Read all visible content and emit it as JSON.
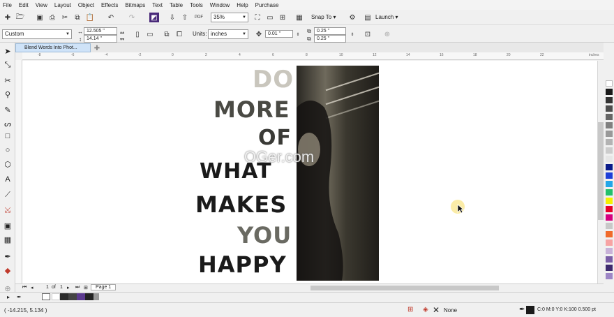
{
  "menu": [
    "File",
    "Edit",
    "View",
    "Layout",
    "Object",
    "Effects",
    "Bitmaps",
    "Text",
    "Table",
    "Tools",
    "Window",
    "Help",
    "Purchase"
  ],
  "toolbar": {
    "zoom_value": "35%",
    "snap_label": "Snap To",
    "launch_label": "Launch",
    "page_preset": "Custom",
    "width_value": "12.505 \"",
    "height_value": "14.14 \"",
    "units_label": "Units:",
    "units_value": "inches",
    "nudge_value": "0.01 \"",
    "dup_x": "0.25 \"",
    "dup_y": "0.25 \""
  },
  "document": {
    "tab_title": "Blend Words Into Phot..."
  },
  "ruler": {
    "h_ticks": [
      "-8",
      "-6",
      "-4",
      "-2",
      "0",
      "2",
      "4",
      "6",
      "8",
      "10",
      "12",
      "14",
      "16",
      "18",
      "20",
      "22"
    ],
    "unit": "inches"
  },
  "artwork": {
    "lines": [
      "DO",
      "MORE",
      "OF",
      "WHAT",
      "MAKES",
      "YOU",
      "HAPPY"
    ],
    "watermark": "OGer.com"
  },
  "page_nav": {
    "current": "1",
    "of_label": "of",
    "total": "1",
    "page_tab": "Page 1"
  },
  "status": {
    "coords": "( -14.215, 5.134 )",
    "fill_label": "None",
    "outline_label": "C:0 M:0 Y:0 K:100  0.500 pt"
  },
  "colors": {
    "accent": "#0078d7",
    "palette": [
      "#ffffff",
      "#1a1a1a",
      "#333333",
      "#4d4d4d",
      "#666666",
      "#808080",
      "#999999",
      "#b3b3b3",
      "#cccccc",
      "#e6e6e6",
      "#0a1b8a",
      "#1d3fd8",
      "#22a6e8",
      "#22c06b",
      "#f5f000",
      "#e8002a",
      "#d6007f",
      "#c8c8c8",
      "#f06a2a",
      "#f7a3a3",
      "#c8b2d8",
      "#7a5ea6",
      "#3d2a6e",
      "#9d86c6"
    ]
  }
}
